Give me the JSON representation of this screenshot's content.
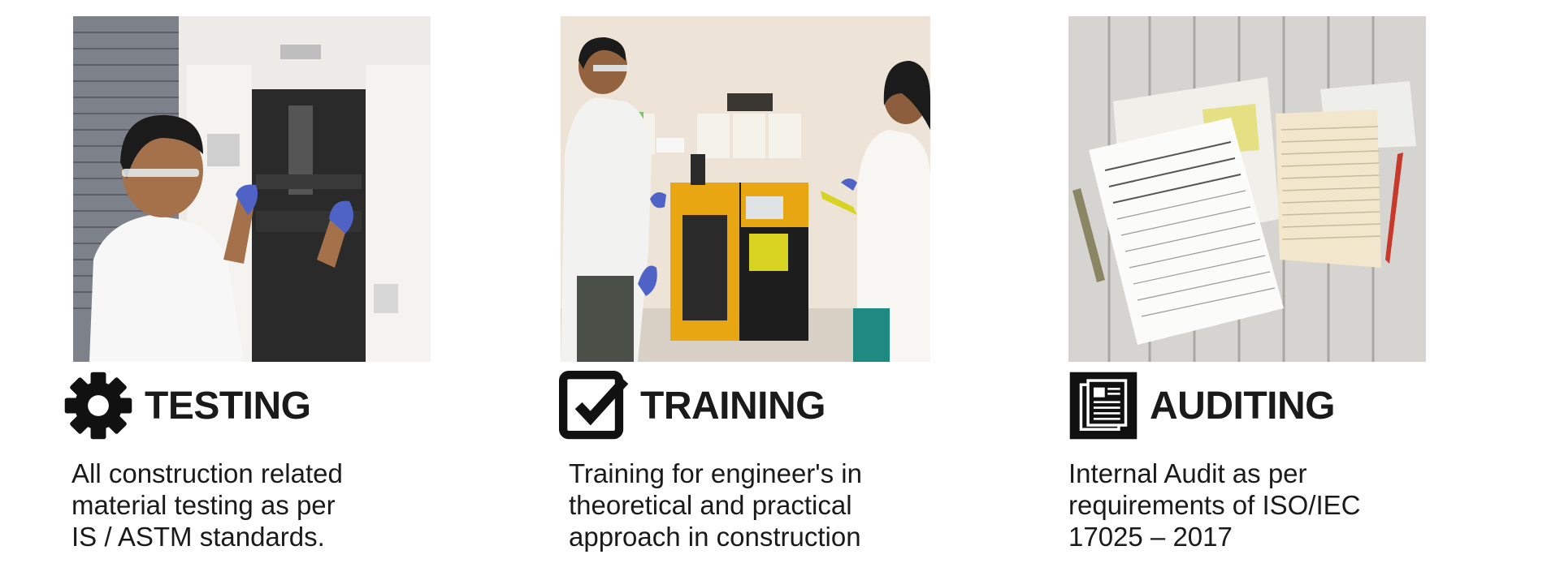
{
  "sections": [
    {
      "title": "TESTING",
      "icon": "gear-icon",
      "photo": "engineer-operating-testing-machine",
      "description_lines": [
        "All construction related",
        "material testing as per",
        "IS / ASTM standards."
      ]
    },
    {
      "title": "TRAINING",
      "icon": "checkbox-check-icon",
      "photo": "trainer-and-trainee-at-compression-machine",
      "description_lines": [
        "Training for engineer's in",
        "theoretical and practical",
        "approach in construction"
      ]
    },
    {
      "title": "AUDITING",
      "icon": "document-icon",
      "photo": "audit-forms-on-wooden-table",
      "description_lines": [
        "Internal Audit as per",
        "requirements of ISO/IEC",
        "17025 – 2017"
      ]
    }
  ],
  "colors": {
    "text": "#1a1a1a",
    "icon": "#111111",
    "machine_yellow": "#e8a612",
    "gloves": "#4f63c7"
  }
}
